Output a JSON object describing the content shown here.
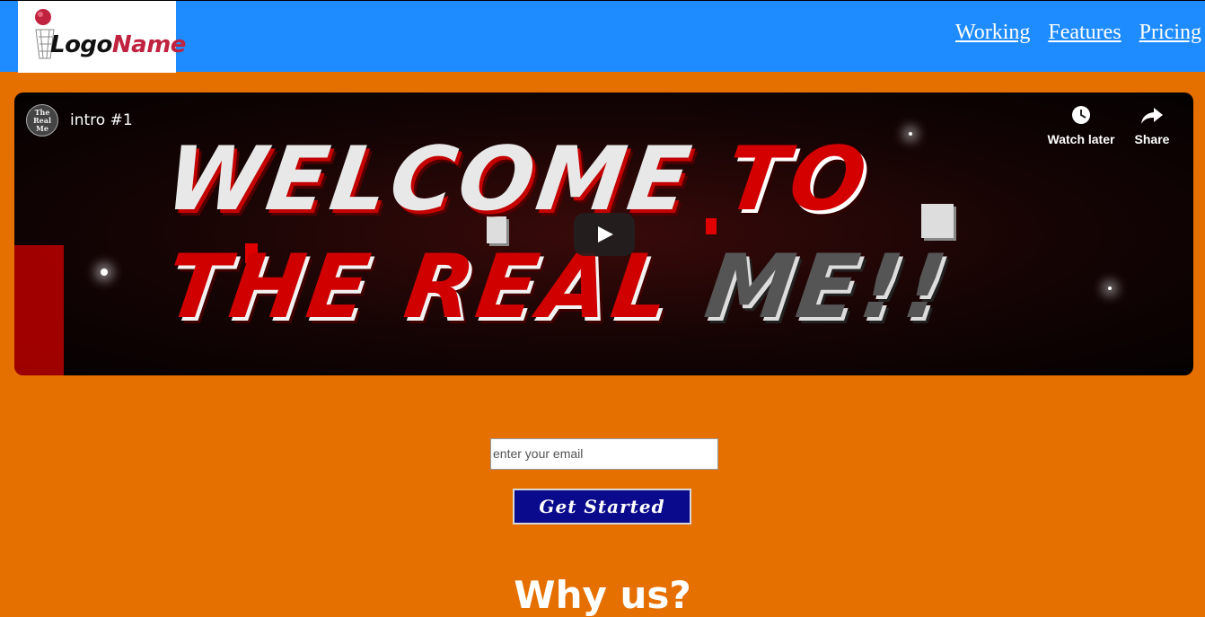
{
  "header": {
    "logo": {
      "word1": "Logo",
      "word2": "Name"
    },
    "nav": [
      {
        "label": "Working"
      },
      {
        "label": "Features"
      },
      {
        "label": "Pricing"
      }
    ]
  },
  "video": {
    "channel_avatar": "The Real Me",
    "title": "intro #1",
    "watch_later": "Watch later",
    "share": "Share",
    "thumbnail": {
      "line1a": "WELCOME",
      "line1b": "TO",
      "line2a": "THE REAL",
      "line2b": "ME!!"
    },
    "icons": {
      "play": "play-icon",
      "clock": "clock-icon",
      "share": "share-arrow-icon"
    }
  },
  "signup": {
    "email_placeholder": "enter your email",
    "button_label": "Get Started"
  },
  "section": {
    "why_title": "Why us?"
  },
  "colors": {
    "header_bg": "#1e8cff",
    "page_bg": "#e57000",
    "button_bg": "#0a0a8c",
    "logo_accent": "#c0233f"
  }
}
